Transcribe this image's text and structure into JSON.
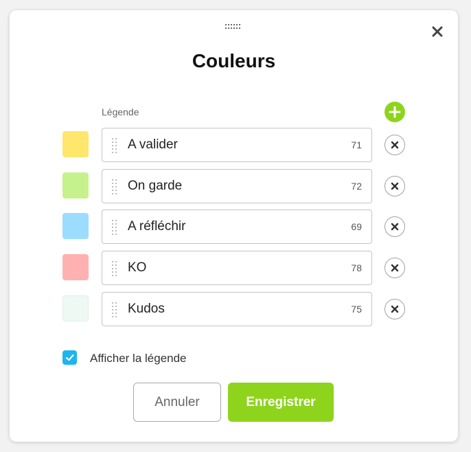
{
  "dialog": {
    "title": "Couleurs",
    "legend_header": "Légende",
    "show_legend_label": "Afficher la légende",
    "show_legend_checked": true,
    "cancel_label": "Annuler",
    "save_label": "Enregistrer"
  },
  "colors": [
    {
      "label": "A valider",
      "count": "71",
      "swatch": "#ffe66d"
    },
    {
      "label": "On garde",
      "count": "72",
      "swatch": "#c5f28c"
    },
    {
      "label": "A réfléchir",
      "count": "69",
      "swatch": "#9cdcfe"
    },
    {
      "label": "KO",
      "count": "78",
      "swatch": "#ffb1b1"
    },
    {
      "label": "Kudos",
      "count": "75",
      "swatch": "#eef9f3"
    }
  ],
  "theme": {
    "accent_green": "#8ed41c",
    "checkbox_blue": "#1eb4f0"
  },
  "icons": {
    "drag_handle": "drag-grip-icon",
    "close": "close-icon",
    "add": "plus-icon",
    "remove": "x-icon",
    "row_grip": "row-grip-icon",
    "check": "checkmark-icon"
  }
}
